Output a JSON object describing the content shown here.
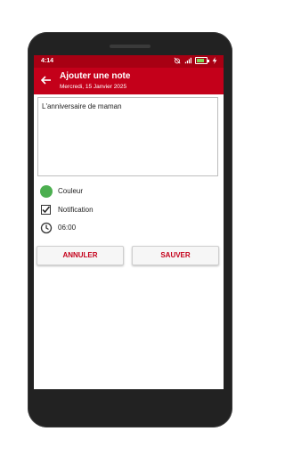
{
  "statusbar": {
    "time": "4:14"
  },
  "toolbar": {
    "title": "Ajouter une note",
    "subtitle": "Mercredi, 15 Janvier 2025"
  },
  "note": {
    "text": "L'anniversaire de maman"
  },
  "options": {
    "color_label": "Couleur",
    "color_value": "#4caf50",
    "notification_label": "Notification",
    "notification_checked": true,
    "time_value": "06:00"
  },
  "buttons": {
    "cancel": "ANNULER",
    "save": "SAUVER"
  },
  "colors": {
    "status_bar": "#a80013",
    "toolbar": "#c4001a",
    "accent": "#c4001a"
  },
  "battery": {
    "level": 0.8
  }
}
